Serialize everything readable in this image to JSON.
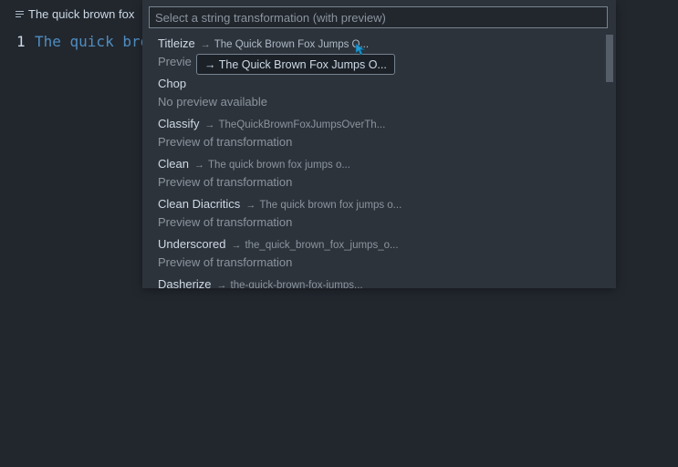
{
  "tab": {
    "icon": "lines-icon",
    "title": "The quick brown fox"
  },
  "editor": {
    "line_number": "1",
    "code": "The quick brown fox jumps over the lazy dog"
  },
  "picker": {
    "placeholder": "Select a string transformation (with preview)",
    "items": [
      {
        "label": "Titleize",
        "arrow": "→",
        "preview": "The Quick Brown Fox Jumps O...",
        "desc": "Previe"
      },
      {
        "label": "Chop",
        "arrow": "",
        "preview": "",
        "desc": "No preview available"
      },
      {
        "label": "Classify",
        "arrow": "→",
        "preview": "TheQuickBrownFoxJumpsOverTh...",
        "desc": "Preview of transformation"
      },
      {
        "label": "Clean",
        "arrow": "→",
        "preview": "The quick brown fox jumps o...",
        "desc": "Preview of transformation"
      },
      {
        "label": "Clean Diacritics",
        "arrow": "→",
        "preview": "The quick brown fox jumps o...",
        "desc": "Preview of transformation"
      },
      {
        "label": "Underscored",
        "arrow": "→",
        "preview": "the_quick_brown_fox_jumps_o...",
        "desc": "Preview of transformation"
      },
      {
        "label": "Dasherize",
        "arrow": "→",
        "preview": "the-quick-brown-fox-jumps...",
        "desc": ""
      }
    ],
    "tooltip": "→ The Quick Brown Fox Jumps O..."
  },
  "colors": {
    "background": "#22272e",
    "panel": "#2d333b",
    "accent_cursor": "#1f9ad6"
  }
}
